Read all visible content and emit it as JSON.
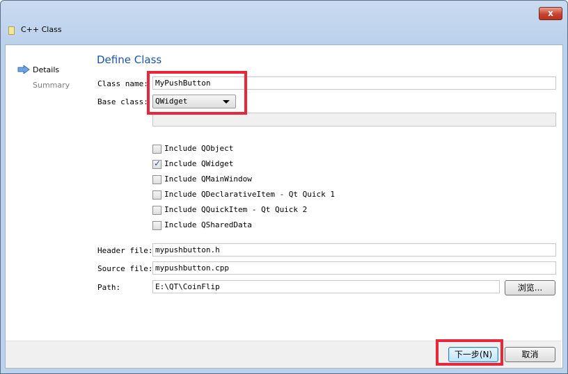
{
  "window": {
    "title": "C++ Class",
    "close_glyph": "x"
  },
  "nav": {
    "items": [
      {
        "label": "Details"
      },
      {
        "label": "Summary"
      }
    ]
  },
  "page": {
    "heading": "Define Class"
  },
  "form": {
    "class_name_label": "Class name:",
    "class_name_value": "MyPushButton",
    "base_class_label": "Base class:",
    "base_class_value": "QWidget",
    "checkboxes": [
      {
        "label": "Include QObject",
        "checked": false
      },
      {
        "label": "Include QWidget",
        "checked": true
      },
      {
        "label": "Include QMainWindow",
        "checked": false
      },
      {
        "label": "Include QDeclarativeItem - Qt Quick 1",
        "checked": false
      },
      {
        "label": "Include QQuickItem - Qt Quick 2",
        "checked": false
      },
      {
        "label": "Include QSharedData",
        "checked": false
      }
    ],
    "header_file_label": "Header file:",
    "header_file_value": "mypushbutton.h",
    "source_file_label": "Source file:",
    "source_file_value": "mypushbutton.cpp",
    "path_label": "Path:",
    "path_value": "E:\\QT\\CoinFlip",
    "browse_label": "浏览..."
  },
  "footer": {
    "next_label": "下一步(N)",
    "cancel_label": "取消"
  },
  "colors": {
    "highlight": "#e8283a",
    "heading": "#1a55a8",
    "accent": "#2a4f9a"
  }
}
